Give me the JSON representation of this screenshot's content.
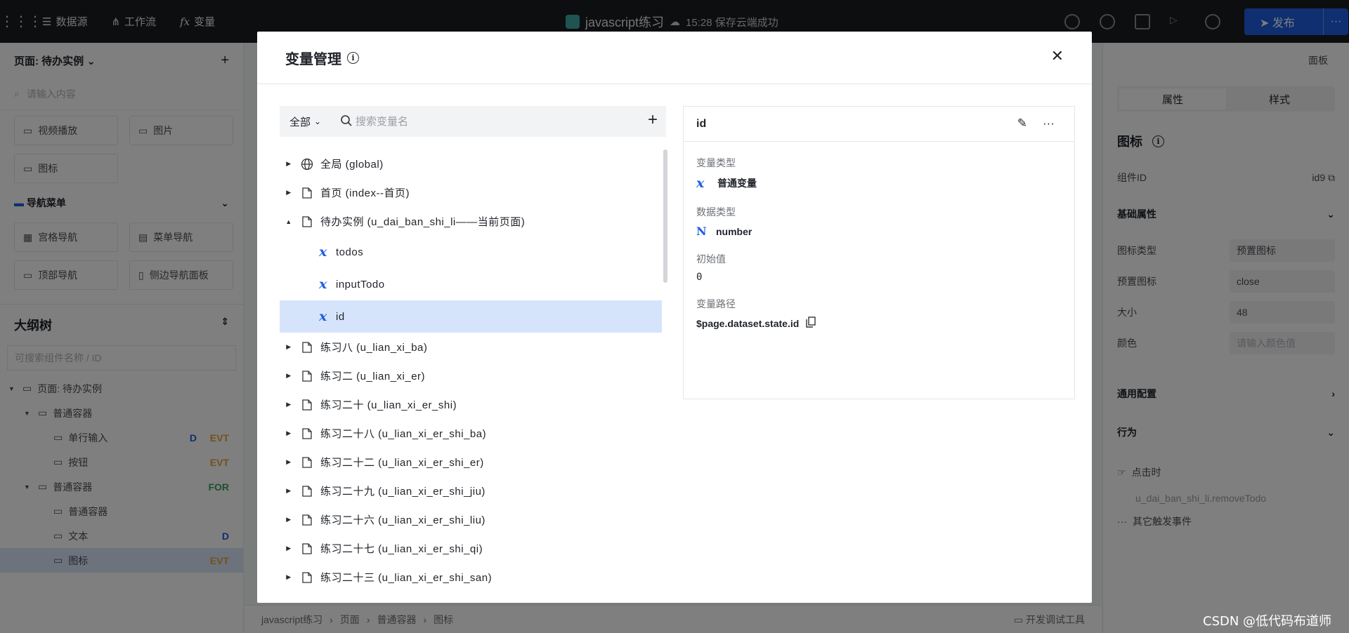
{
  "topbar": {
    "nav": [
      {
        "label": "数据源",
        "icon": "database-icon"
      },
      {
        "label": "工作流",
        "icon": "workflow-icon"
      },
      {
        "label": "变量",
        "icon": "function-icon"
      }
    ],
    "project_title": "javascript练习",
    "save_status": "15:28 保存云端成功",
    "publish_label": "发布",
    "publish_more": "···"
  },
  "left": {
    "page_title": "页面: 待办实例",
    "search_placeholder": "请输入内容",
    "components_top": [
      "视频播放",
      "图片"
    ],
    "component_icon": "图标",
    "nav_section": "导航菜单",
    "nav_components": [
      "宫格导航",
      "菜单导航",
      "顶部导航",
      "侧边导航面板"
    ],
    "outline_title": "大纲树",
    "outline_search_placeholder": "可搜索组件名称 / ID",
    "outline": [
      {
        "label": "页面: 待办实例",
        "indent": 0
      },
      {
        "label": "普通容器",
        "indent": 1
      },
      {
        "label": "单行输入",
        "indent": 2,
        "tags": [
          "D",
          "EVT"
        ]
      },
      {
        "label": "按钮",
        "indent": 2,
        "tags": [
          "EVT"
        ]
      },
      {
        "label": "普通容器",
        "indent": 1,
        "tags": [
          "FOR"
        ]
      },
      {
        "label": "普通容器",
        "indent": 2
      },
      {
        "label": "文本",
        "indent": 2,
        "tags": [
          "D"
        ]
      },
      {
        "label": "图标",
        "indent": 2,
        "tags": [
          "EVT"
        ],
        "selected": true
      }
    ]
  },
  "right": {
    "top_label": "面板",
    "tabs": [
      "属性",
      "样式"
    ],
    "comp_title": "图标",
    "comp_id_label": "组件ID",
    "comp_id_value": "id9",
    "basic_section": "基础属性",
    "props": [
      {
        "label": "图标类型",
        "value": "预置图标"
      },
      {
        "label": "预置图标",
        "value": "close"
      },
      {
        "label": "大小",
        "value": "48"
      },
      {
        "label": "颜色",
        "value": "请输入颜色值"
      }
    ],
    "general_section": "通用配置",
    "behavior_section": "行为",
    "event_label": "点击时",
    "event_handler": "u_dai_ban_shi_li.removeTodo",
    "other_events": "其它触发事件"
  },
  "bottombar": {
    "breadcrumb": [
      "javascript练习",
      "页面",
      "普通容器",
      "图标"
    ],
    "devtool": "开发调试工具"
  },
  "modal": {
    "title": "变量管理",
    "scope": "全部",
    "search_placeholder": "搜索变量名",
    "tree": [
      {
        "kind": "global",
        "label": "全局 (global)",
        "expanded": false
      },
      {
        "kind": "page",
        "label": "首页 (index--首页)",
        "expanded": false
      },
      {
        "kind": "page",
        "label": "待办实例 (u_dai_ban_shi_li——当前页面)",
        "expanded": true
      },
      {
        "kind": "var",
        "label": "todos"
      },
      {
        "kind": "var",
        "label": "inputTodo"
      },
      {
        "kind": "var",
        "label": "id",
        "selected": true
      },
      {
        "kind": "page",
        "label": "练习八 (u_lian_xi_ba)",
        "expanded": false
      },
      {
        "kind": "page",
        "label": "练习二 (u_lian_xi_er)",
        "expanded": false
      },
      {
        "kind": "page",
        "label": "练习二十 (u_lian_xi_er_shi)",
        "expanded": false
      },
      {
        "kind": "page",
        "label": "练习二十八 (u_lian_xi_er_shi_ba)",
        "expanded": false
      },
      {
        "kind": "page",
        "label": "练习二十二 (u_lian_xi_er_shi_er)",
        "expanded": false
      },
      {
        "kind": "page",
        "label": "练习二十九 (u_lian_xi_er_shi_jiu)",
        "expanded": false
      },
      {
        "kind": "page",
        "label": "练习二十六 (u_lian_xi_er_shi_liu)",
        "expanded": false
      },
      {
        "kind": "page",
        "label": "练习二十七 (u_lian_xi_er_shi_qi)",
        "expanded": false
      },
      {
        "kind": "page",
        "label": "练习二十三 (u_lian_xi_er_shi_san)",
        "expanded": false
      }
    ],
    "detail": {
      "name": "id",
      "var_type_label": "变量类型",
      "var_type_value": "普通变量",
      "data_type_label": "数据类型",
      "data_type_value": "number",
      "init_label": "初始值",
      "init_value": "0",
      "path_label": "变量路径",
      "path_value": "$page.dataset.state.id"
    }
  },
  "watermark": "CSDN @低代码布道师",
  "colors": {
    "accent": "#1f5fe0",
    "selected_row": "#d6e4fb",
    "topbar": "#1a1c20",
    "evt_tag": "#e8a33c",
    "d_tag": "#1f5fe0",
    "for_tag": "#3aa35a"
  }
}
